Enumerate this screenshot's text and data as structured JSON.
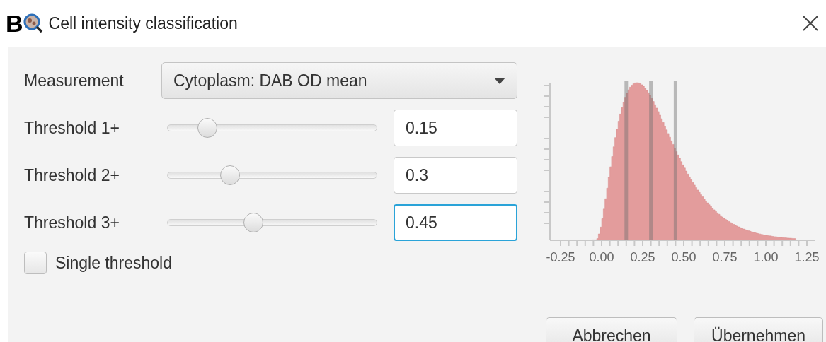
{
  "figure_label": "B",
  "window": {
    "title": "Cell intensity classification"
  },
  "measurement": {
    "label": "Measurement",
    "value": "Cytoplasm: DAB OD mean"
  },
  "thresholds": [
    {
      "label": "Threshold 1+",
      "level": 0.16,
      "value": "0.15",
      "focused": false
    },
    {
      "label": "Threshold 2+",
      "level": 0.28,
      "value": "0.3",
      "focused": false
    },
    {
      "label": "Threshold 3+",
      "level": 0.4,
      "value": "0.45",
      "focused": true
    }
  ],
  "single_threshold": {
    "label": "Single threshold",
    "checked": false
  },
  "histogram": {
    "x_tick_labels": [
      "-0.25",
      "0.00",
      "0.25",
      "0.50",
      "0.75",
      "1.00",
      "1.25"
    ]
  },
  "buttons": [
    "Abbrechen",
    "Übernehmen"
  ]
}
